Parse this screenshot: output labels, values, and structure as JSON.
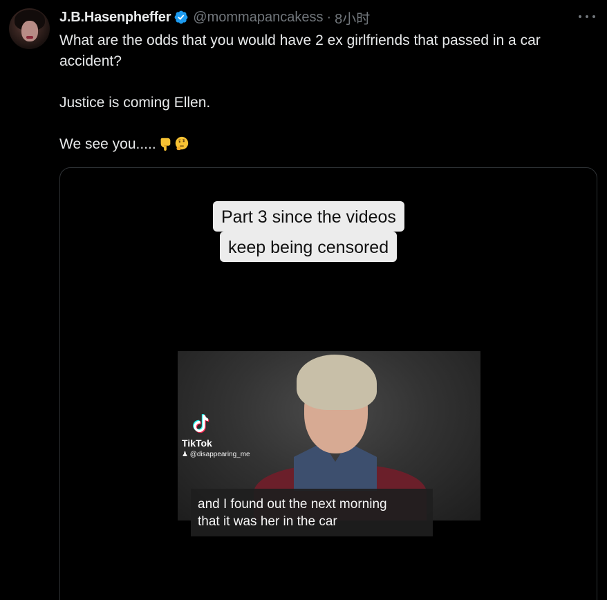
{
  "tweet": {
    "display_name": "J.B.Hasenpheffer",
    "handle": "@mommapancakess",
    "separator": "·",
    "time": "8小时",
    "verified": true,
    "avatar_icon": "profile-photo",
    "more_icon": "ellipsis-icon",
    "text_lines": [
      "What are the odds that you would have 2 ex girlfriends that passed in a car accident?",
      "Justice is coming Ellen.",
      "We see you....."
    ],
    "emojis": [
      "backhand-index-pointing-down",
      "thinking-face"
    ]
  },
  "media": {
    "caption_line1": "Part 3 since the videos",
    "caption_line2": "keep being censored",
    "tiktok_label": "TikTok",
    "tiktok_user": "@disappearing_me",
    "subtitle_line1": "and I found out the next morning",
    "subtitle_line2": "that it was her in the car"
  },
  "colors": {
    "background": "#000000",
    "text_primary": "#e7e9ea",
    "text_secondary": "#71767b",
    "verified_blue": "#1d9bf0",
    "border": "#2f3336"
  }
}
